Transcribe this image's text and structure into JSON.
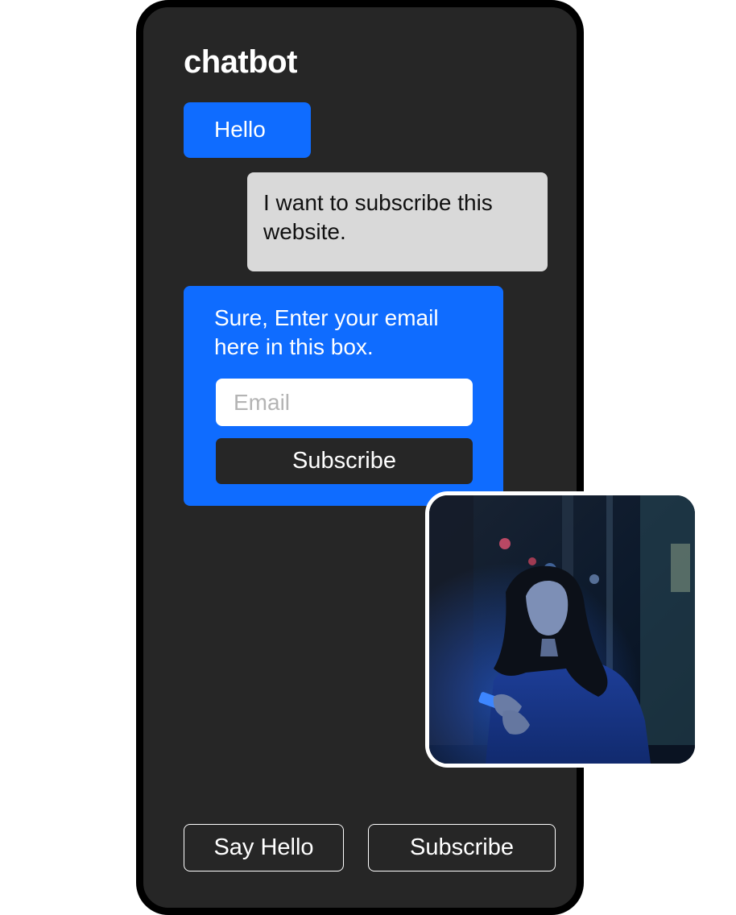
{
  "app": {
    "title": "chatbot"
  },
  "messages": {
    "greeting": "Hello",
    "user_request": "I want to subscribe this website.",
    "bot_reply": "Sure, Enter your email here in this box."
  },
  "subscribe_form": {
    "email_placeholder": "Email",
    "email_value": "",
    "button_label": "Subscribe"
  },
  "quick_replies": {
    "say_hello_label": "Say Hello",
    "subscribe_label": "Subscribe"
  },
  "colors": {
    "accent_blue": "#0f6cff",
    "phone_background": "#262626",
    "user_bubble": "#d9d9d9"
  },
  "icons": {
    "photo": "person-with-phone-photo"
  }
}
